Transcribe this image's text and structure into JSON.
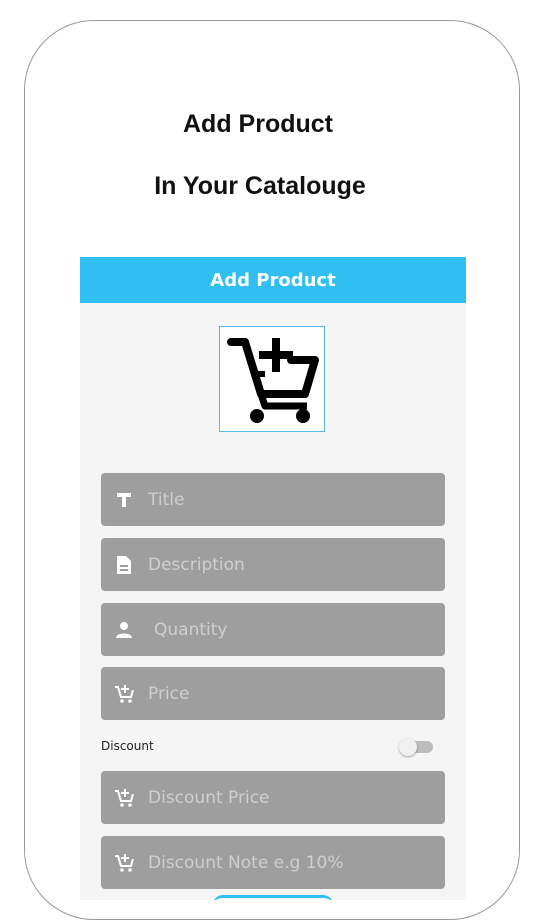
{
  "page": {
    "heading_line1": "Add Product",
    "heading_line2": "In Your Catalouge"
  },
  "app_bar": {
    "title": "Add Product",
    "color": "#30bff0"
  },
  "product_image": {
    "icon": "add-to-cart-icon"
  },
  "form": {
    "title_placeholder": "Title",
    "description_placeholder": "Description",
    "quantity_placeholder": "Quantity",
    "price_placeholder": "Price",
    "discount_label": "Discount",
    "discount_enabled": false,
    "discount_price_placeholder": "Discount Price",
    "discount_note_placeholder": "Discount Note e.g 10%"
  },
  "colors": {
    "field_bg": "#9e9e9e",
    "placeholder": "#cfcfcf",
    "screen_bg": "#f5f5f5"
  }
}
